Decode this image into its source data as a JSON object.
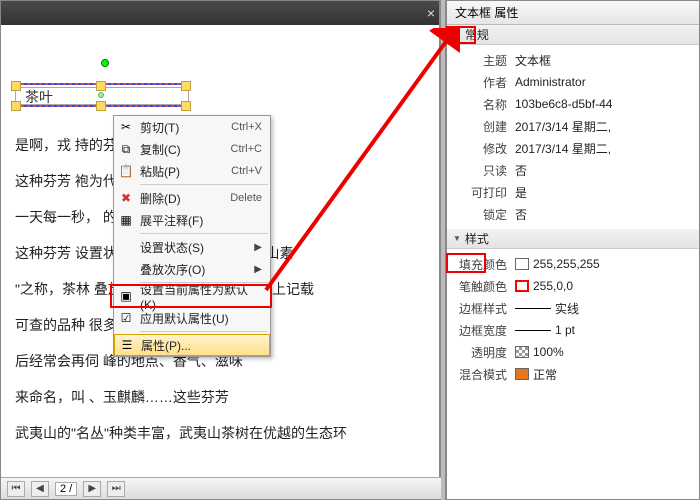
{
  "left": {
    "close_btn": "×",
    "textbox_content": "茶叶",
    "body_lines": [
      "是啊，戎                                    持的芬芳",
      "这种芬芳                                    袍为代表的武夷岩茶，",
      "一天每一秒，                                  的色彩。",
      "这种芬芳      设置状态(S)                  夷茶树品种。武夷山素",
      "\"之称，茶林   叠放次序(O)                ，据《茶叶志》上记载",
      "可查的品种                                  很多的\"花名\"，历代",
      "后经常会再伺                              峰的地点、香气、滋味",
      "来命名，叫                             、玉麒麟……这些芬芳",
      "武夷山的\"名丛\"种类丰富，武夷山茶树在优越的生态环"
    ]
  },
  "context_menu": {
    "cut": {
      "label": "剪切(T)",
      "shortcut": "Ctrl+X"
    },
    "copy": {
      "label": "复制(C)",
      "shortcut": "Ctrl+C"
    },
    "paste": {
      "label": "粘贴(P)",
      "shortcut": "Ctrl+V"
    },
    "delete": {
      "label": "删除(D)",
      "shortcut": "Delete"
    },
    "flatten": {
      "label": "展平注释(F)"
    },
    "state": {
      "label": "设置状态(S)"
    },
    "order": {
      "label": "叠放次序(O)"
    },
    "setdefault": {
      "label": "设置当前属性为默认(K)"
    },
    "applydefault": {
      "label": "应用默认属性(U)"
    },
    "properties": {
      "label": "属性(P)..."
    }
  },
  "right": {
    "title": "文本框 属性",
    "general_head": "常规",
    "style_head": "样式",
    "subject": {
      "label": "主题",
      "value": "文本框"
    },
    "author": {
      "label": "作者",
      "value": "Administrator"
    },
    "name": {
      "label": "名称",
      "value": "103be6c8-d5bf-44"
    },
    "created": {
      "label": "创建",
      "value": "2017/3/14 星期二,"
    },
    "modified": {
      "label": "修改",
      "value": "2017/3/14 星期二,"
    },
    "readonly": {
      "label": "只读",
      "value": "否"
    },
    "printable": {
      "label": "可打印",
      "value": "是"
    },
    "locked": {
      "label": "锁定",
      "value": "否"
    },
    "fillcolor": {
      "label": "填充颜色",
      "value": "255,255,255"
    },
    "strokecolor": {
      "label": "笔触颜色",
      "value": "255,0,0"
    },
    "borderstyle": {
      "label": "边框样式",
      "value": "实线"
    },
    "borderwidth": {
      "label": "边框宽度",
      "value": "1 pt"
    },
    "opacity": {
      "label": "透明度",
      "value": "100%"
    },
    "blend": {
      "label": "混合模式",
      "value": "正常"
    }
  },
  "bottombar": {
    "page": "2 /"
  }
}
